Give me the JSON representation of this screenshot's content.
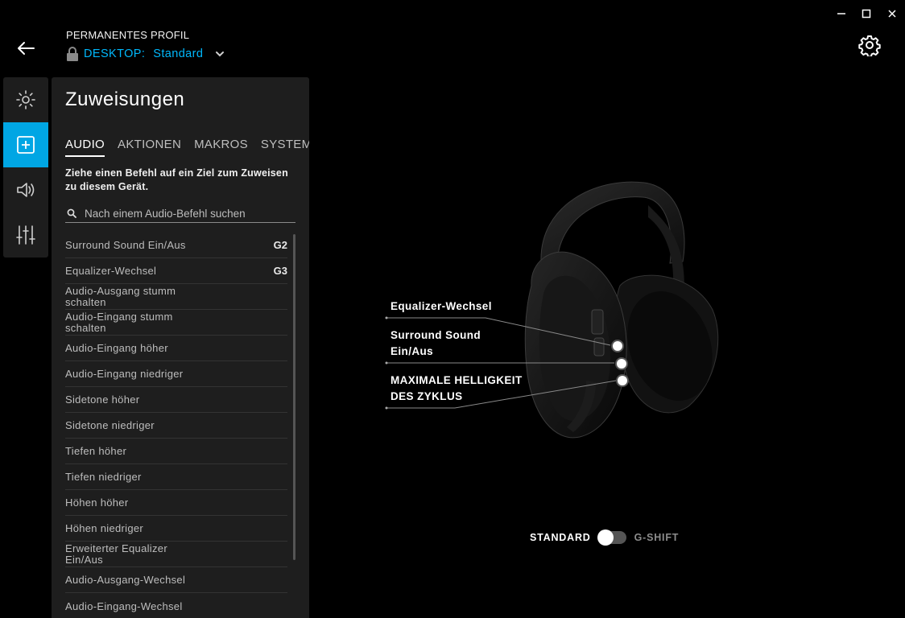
{
  "header": {
    "profile_label": "PERMANENTES PROFIL",
    "profile_key": "DESKTOP:",
    "profile_value": "Standard"
  },
  "sidebar": {
    "items": [
      {
        "icon": "brightness-icon",
        "active": false
      },
      {
        "icon": "assignments-icon",
        "active": true
      },
      {
        "icon": "speaker-icon",
        "active": false
      },
      {
        "icon": "equalizer-icon",
        "active": false
      }
    ]
  },
  "panel": {
    "title": "Zuweisungen",
    "tabs": [
      "AUDIO",
      "AKTIONEN",
      "MAKROS",
      "SYSTEM"
    ],
    "instruction": "Ziehe einen Befehl auf ein Ziel zum Zuweisen zu diesem Gerät.",
    "search_placeholder": "Nach einem Audio-Befehl suchen",
    "items": [
      {
        "label": "Surround Sound Ein/Aus",
        "key": "G2"
      },
      {
        "label": "Equalizer-Wechsel",
        "key": "G3"
      },
      {
        "label": "Audio-Ausgang stumm schalten",
        "key": ""
      },
      {
        "label": "Audio-Eingang stumm schalten",
        "key": ""
      },
      {
        "label": "Audio-Eingang höher",
        "key": ""
      },
      {
        "label": "Audio-Eingang niedriger",
        "key": ""
      },
      {
        "label": "Sidetone höher",
        "key": ""
      },
      {
        "label": "Sidetone niedriger",
        "key": ""
      },
      {
        "label": "Tiefen höher",
        "key": ""
      },
      {
        "label": "Tiefen niedriger",
        "key": ""
      },
      {
        "label": "Höhen höher",
        "key": ""
      },
      {
        "label": "Höhen niedriger",
        "key": ""
      },
      {
        "label": "Erweiterter Equalizer Ein/Aus",
        "key": ""
      },
      {
        "label": "Audio-Ausgang-Wechsel",
        "key": ""
      },
      {
        "label": "Audio-Eingang-Wechsel",
        "key": ""
      }
    ]
  },
  "stage": {
    "callouts": [
      "Equalizer-Wechsel",
      "Surround Sound Ein/Aus",
      "MAXIMALE HELLIGKEIT DES ZYKLUS"
    ],
    "toggle_left": "STANDARD",
    "toggle_right": "G-SHIFT",
    "toggle_on": false
  },
  "colors": {
    "accent": "#00a6e4",
    "profile_text": "#00b8fc",
    "panel_bg": "#1e1e1e"
  }
}
